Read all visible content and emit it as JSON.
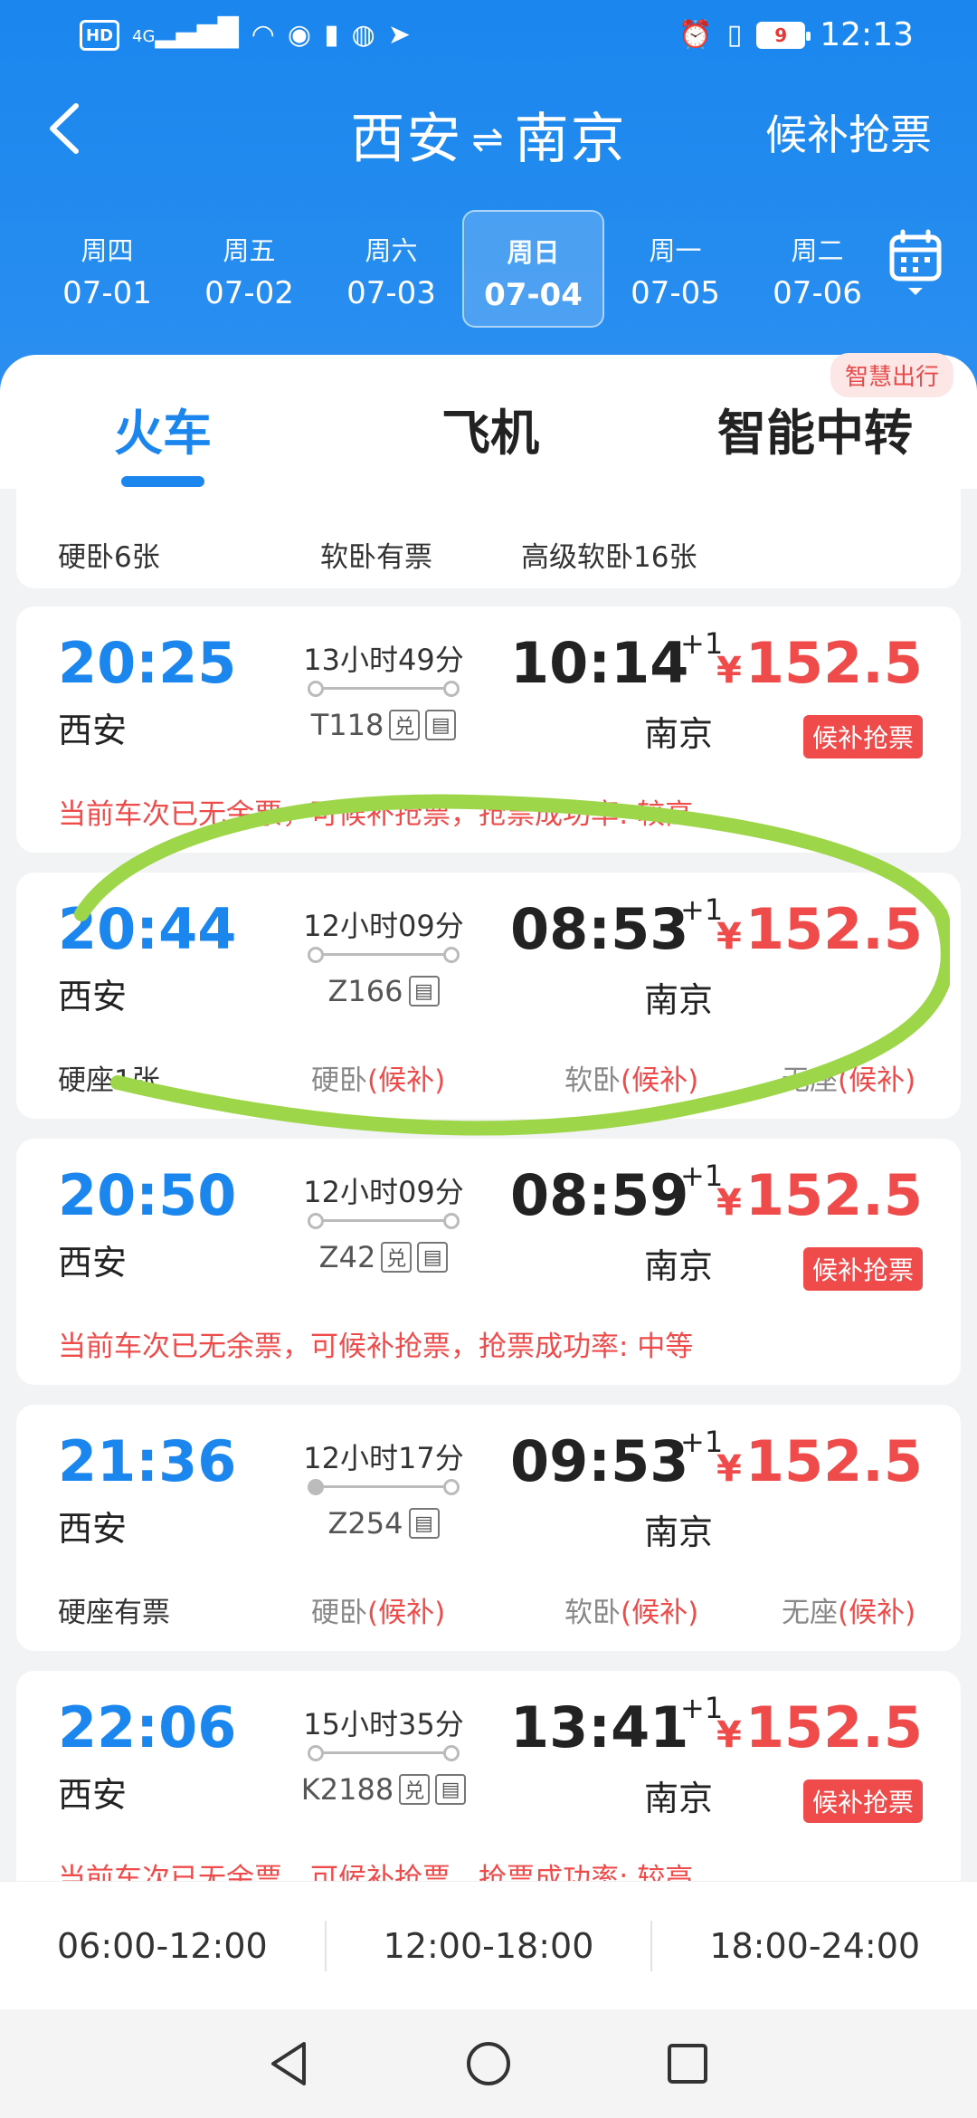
{
  "status_bar": {
    "hd": "HD",
    "signal": "4G",
    "battery": "9",
    "time": "12:13"
  },
  "nav": {
    "from": "西安",
    "swap": "⇌",
    "to": "南京",
    "right_action": "候补抢票"
  },
  "dates": [
    {
      "weekday": "周四",
      "date": "07-01"
    },
    {
      "weekday": "周五",
      "date": "07-02"
    },
    {
      "weekday": "周六",
      "date": "07-03"
    },
    {
      "weekday": "周日",
      "date": "07-04"
    },
    {
      "weekday": "周一",
      "date": "07-05"
    },
    {
      "weekday": "周二",
      "date": "07-06"
    }
  ],
  "modes": {
    "train": "火车",
    "plane": "飞机",
    "transfer": "智能中转",
    "smart_badge": "智慧出行"
  },
  "partial_card": {
    "seats": [
      "硬卧6张",
      "软卧有票",
      "高级软卧16张"
    ]
  },
  "trains": [
    {
      "dep_time": "20:25",
      "dep_station": "西安",
      "duration": "13小时49分",
      "train_no": "T118",
      "arr_time": "10:14",
      "plus_day": "+1",
      "arr_station": "南京",
      "currency": "¥",
      "price": "152.5",
      "badge": "候补抢票",
      "notice": "当前车次已无余票，可候补抢票，抢票成功率: 较高"
    },
    {
      "dep_time": "20:44",
      "dep_station": "西安",
      "duration": "12小时09分",
      "train_no": "Z166",
      "arr_time": "08:53",
      "plus_day": "+1",
      "arr_station": "南京",
      "currency": "¥",
      "price": "152.5",
      "seat1": "硬座1张",
      "seat2_name": "硬卧",
      "seat2_status": "(候补)",
      "seat3_name": "软卧",
      "seat3_status": "(候补)",
      "seat4_name": "无座",
      "seat4_status": "(候补)"
    },
    {
      "dep_time": "20:50",
      "dep_station": "西安",
      "duration": "12小时09分",
      "train_no": "Z42",
      "arr_time": "08:59",
      "plus_day": "+1",
      "arr_station": "南京",
      "currency": "¥",
      "price": "152.5",
      "badge": "候补抢票",
      "notice": "当前车次已无余票，可候补抢票，抢票成功率: 中等"
    },
    {
      "dep_time": "21:36",
      "dep_station": "西安",
      "duration": "12小时17分",
      "train_no": "Z254",
      "arr_time": "09:53",
      "plus_day": "+1",
      "arr_station": "南京",
      "currency": "¥",
      "price": "152.5",
      "seat1": "硬座有票",
      "seat2_name": "硬卧",
      "seat2_status": "(候补)",
      "seat3_name": "软卧",
      "seat3_status": "(候补)",
      "seat4_name": "无座",
      "seat4_status": "(候补)"
    },
    {
      "dep_time": "22:06",
      "dep_station": "西安",
      "duration": "15小时35分",
      "train_no": "K2188",
      "arr_time": "13:41",
      "plus_day": "+1",
      "arr_station": "南京",
      "currency": "¥",
      "price": "152.5",
      "badge": "候补抢票",
      "notice": "当前车次已无余票，可候补抢票，抢票成功率: 较高"
    }
  ],
  "tag_labels": {
    "exchange": "兑",
    "id": "身"
  },
  "time_filter": [
    "06:00-12:00",
    "12:00-18:00",
    "18:00-24:00"
  ],
  "colors": {
    "primary": "#1a86ee",
    "price": "#ef4b4b",
    "annotation": "#9ed64a"
  }
}
